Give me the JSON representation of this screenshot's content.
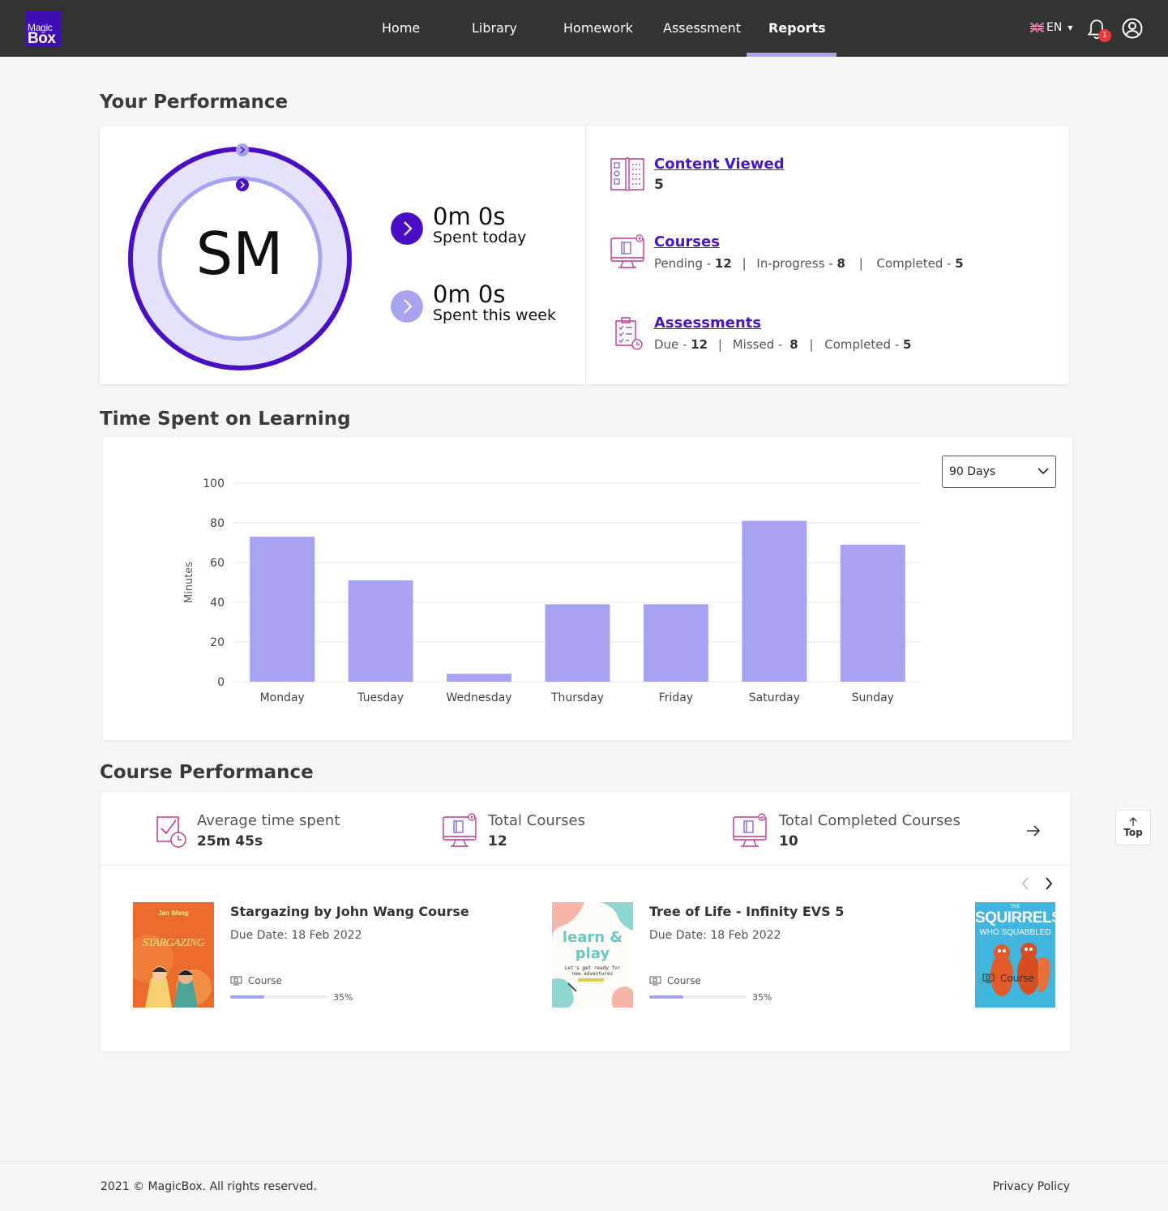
{
  "brand": {
    "line1": "Magic",
    "line2": "Box",
    "color": "#3f0fb3"
  },
  "nav": {
    "items": [
      {
        "label": "Home"
      },
      {
        "label": "Library"
      },
      {
        "label": "Homework"
      },
      {
        "label": "Assessment"
      },
      {
        "label": "Reports",
        "active": true
      }
    ]
  },
  "header": {
    "language": "EN",
    "notification_count": "1",
    "icons": [
      "uk-flag-icon",
      "bell-icon",
      "user-icon"
    ]
  },
  "performance": {
    "title": "Your Performance",
    "initials": "SM",
    "today": {
      "value": "0m 0s",
      "label": "Spent today"
    },
    "week": {
      "value": "0m 0s",
      "label": "Spent this week"
    },
    "content_viewed": {
      "title": "Content Viewed",
      "count": "5"
    },
    "courses": {
      "title": "Courses",
      "pending_label": "Pending - ",
      "pending": "12",
      "inprogress_label": "In-progress - ",
      "inprogress": "8",
      "completed_label": "Completed - ",
      "completed": "5"
    },
    "assessments": {
      "title": "Assessments",
      "due_label": "Due - ",
      "due": "12",
      "missed_label": "Missed - ",
      "missed": "8",
      "completed_label": "Completed - ",
      "completed": "5"
    },
    "colors": {
      "dark": "#4a0fc4",
      "light": "#a6a3f0",
      "fill": "#e4e3fb"
    }
  },
  "time_spent": {
    "title": "Time Spent on Learning",
    "range_select": "90 Days"
  },
  "chart_data": {
    "type": "bar",
    "categories": [
      "Monday",
      "Tuesday",
      "Wednesday",
      "Thursday",
      "Friday",
      "Saturday",
      "Sunday"
    ],
    "values": [
      73,
      51,
      4,
      39,
      39,
      81,
      69
    ],
    "ylabel": "Minutes",
    "ylim": [
      0,
      100
    ],
    "yticks": [
      0,
      20,
      40,
      60,
      80,
      100
    ],
    "grid": true,
    "bar_color": "#a6a3f0"
  },
  "course_performance": {
    "title": "Course Performance",
    "stats": [
      {
        "label": "Average time spent",
        "value": "25m 45s",
        "icon": "clock-check-icon"
      },
      {
        "label": "Total Courses",
        "value": "12",
        "icon": "monitor-book-icon"
      },
      {
        "label": "Total Completed Courses",
        "value": "10",
        "icon": "monitor-check-icon"
      }
    ],
    "courses": [
      {
        "title": "Stargazing by John Wang Course",
        "due": "Due Date: 18 Feb 2022",
        "type": "Course",
        "progress": 35,
        "progress_label": "35%",
        "cover_author": "Jen Wang",
        "cover_title": "STARGAZING"
      },
      {
        "title": "Tree of Life - Infinity EVS 5",
        "due": "Due Date: 18 Feb 2022",
        "type": "Course",
        "progress": 35,
        "progress_label": "35%",
        "cover_title": "learn & play",
        "cover_sub": "Let's get ready for new adventures"
      },
      {
        "type": "Course",
        "cover_title": "SQUIRRELS",
        "cover_sub": "WHO SQUABBLED",
        "cover_top": "THE"
      }
    ]
  },
  "top_button": "Top",
  "footer": {
    "copyright": "2021 © MagicBox. All rights reserved.",
    "privacy": "Privacy Policy"
  }
}
